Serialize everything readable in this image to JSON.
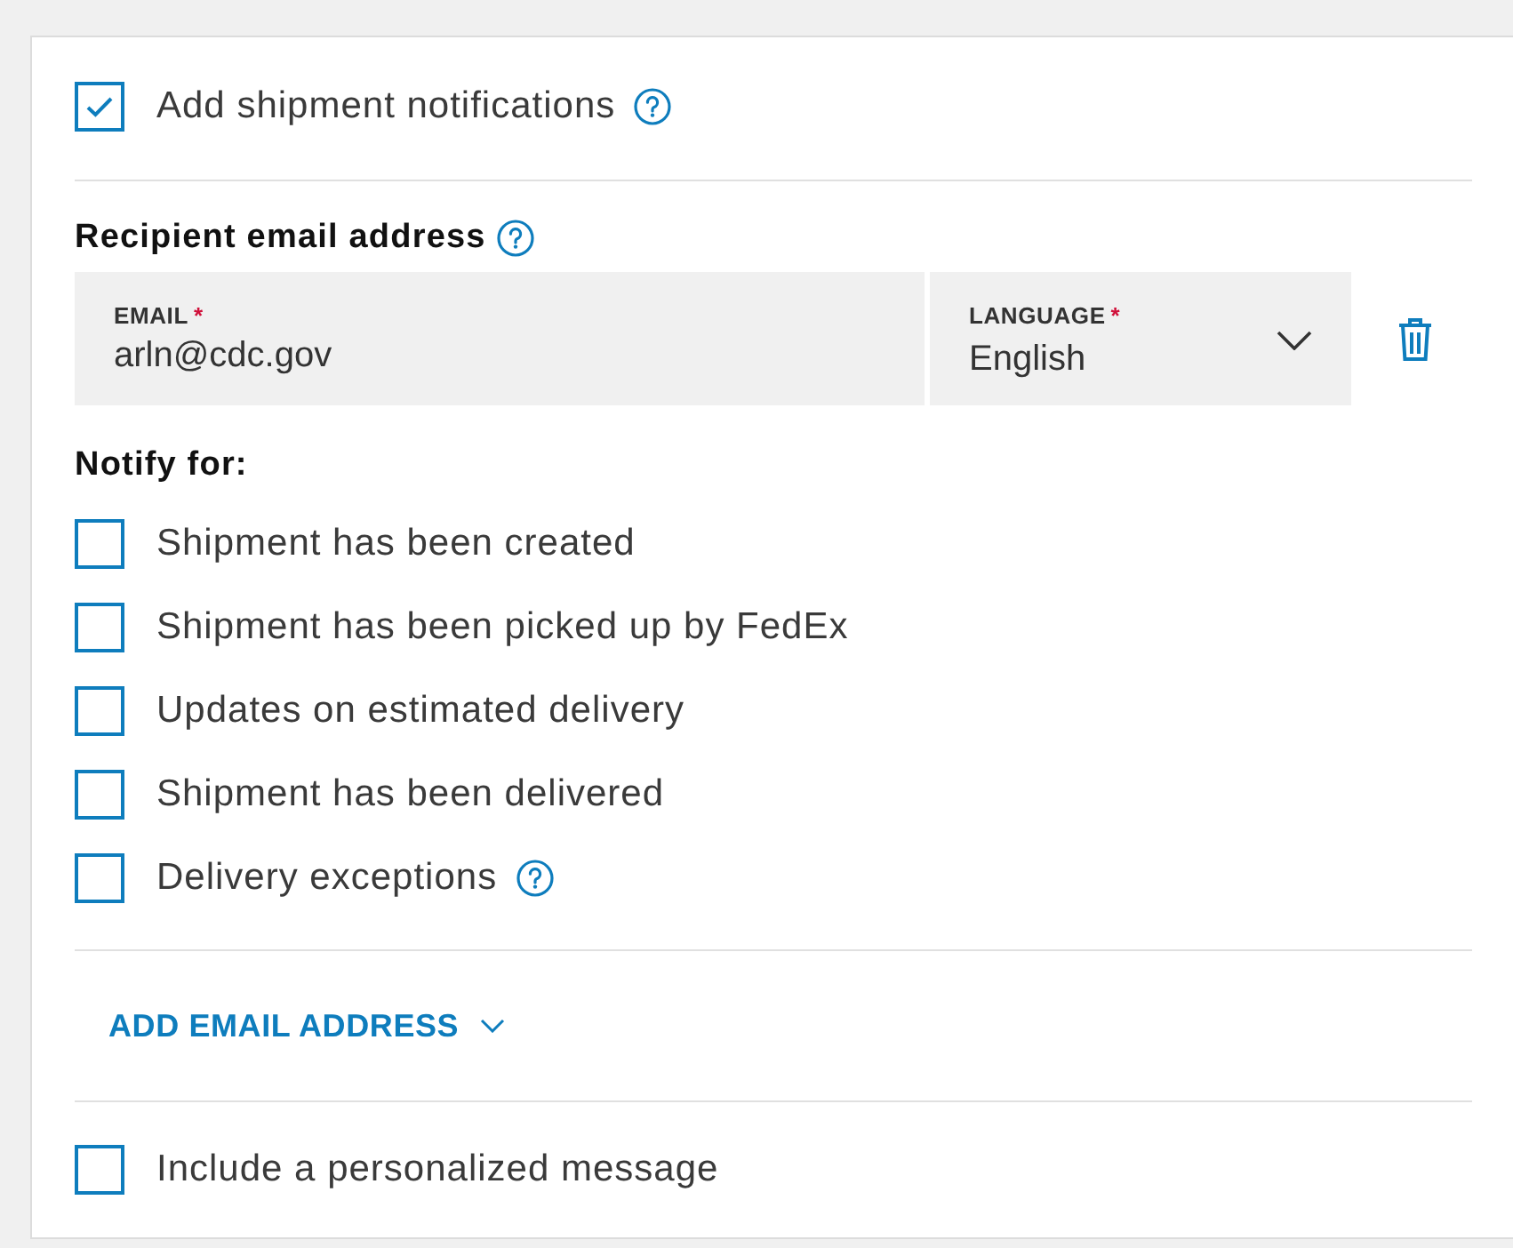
{
  "main_option": {
    "label": "Add shipment notifications",
    "checked": true,
    "help": true
  },
  "recipient": {
    "heading": "Recipient email address",
    "help": true,
    "email": {
      "label": "EMAIL",
      "required_mark": "*",
      "value": "arln@cdc.gov"
    },
    "language": {
      "label": "LANGUAGE",
      "required_mark": "*",
      "value": "English"
    }
  },
  "notify_heading": "Notify for:",
  "notify_options": [
    {
      "label": "Shipment has been created",
      "checked": false,
      "help": false
    },
    {
      "label": "Shipment has been picked up by FedEx",
      "checked": false,
      "help": false
    },
    {
      "label": "Updates on estimated delivery",
      "checked": false,
      "help": false
    },
    {
      "label": "Shipment has been delivered",
      "checked": false,
      "help": false
    },
    {
      "label": "Delivery exceptions",
      "checked": false,
      "help": true
    }
  ],
  "add_email_link": "ADD EMAIL ADDRESS",
  "message_option": {
    "label": "Include a personalized message",
    "checked": false,
    "help": false
  }
}
